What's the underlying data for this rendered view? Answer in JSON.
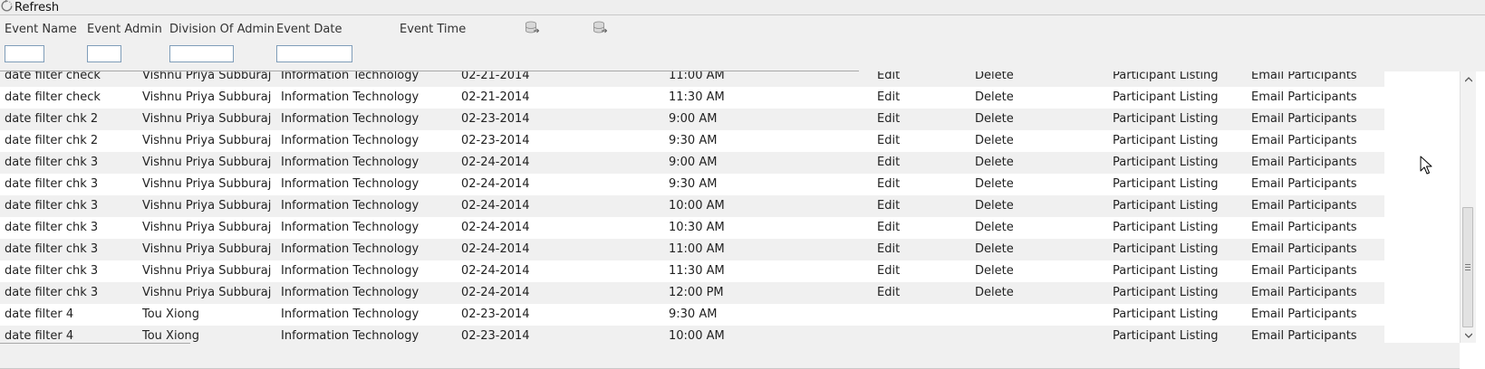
{
  "toolbar": {
    "refresh_label": "Refresh",
    "refresh_icon": "refresh-icon"
  },
  "headers": {
    "event_name": "Event Name",
    "event_admin": "Event Admin",
    "division_of_admin": "Division Of Admin",
    "event_date": "Event Date",
    "event_time": "Event Time",
    "export_icon_1": "database-export-icon",
    "export_icon_2": "database-export-icon"
  },
  "filters": {
    "event_name": "",
    "event_admin": "",
    "division_of_admin": "",
    "event_date": ""
  },
  "rows": [
    {
      "name": "date filter check",
      "admin": "Vishnu Priya Subburaj",
      "division": "Information Technology",
      "date": "02-21-2014",
      "time": "11:00 AM",
      "edit": "Edit",
      "delete": "Delete",
      "participant": "Participant Listing",
      "email": "Email Participants"
    },
    {
      "name": "date filter check",
      "admin": "Vishnu Priya Subburaj",
      "division": "Information Technology",
      "date": "02-21-2014",
      "time": "11:30 AM",
      "edit": "Edit",
      "delete": "Delete",
      "participant": "Participant Listing",
      "email": "Email Participants"
    },
    {
      "name": "date filter chk 2",
      "admin": "Vishnu Priya Subburaj",
      "division": "Information Technology",
      "date": "02-23-2014",
      "time": "9:00 AM",
      "edit": "Edit",
      "delete": "Delete",
      "participant": "Participant Listing",
      "email": "Email Participants"
    },
    {
      "name": "date filter chk 2",
      "admin": "Vishnu Priya Subburaj",
      "division": "Information Technology",
      "date": "02-23-2014",
      "time": "9:30 AM",
      "edit": "Edit",
      "delete": "Delete",
      "participant": "Participant Listing",
      "email": "Email Participants"
    },
    {
      "name": "date filter chk 3",
      "admin": "Vishnu Priya Subburaj",
      "division": "Information Technology",
      "date": "02-24-2014",
      "time": "9:00 AM",
      "edit": "Edit",
      "delete": "Delete",
      "participant": "Participant Listing",
      "email": "Email Participants"
    },
    {
      "name": "date filter chk 3",
      "admin": "Vishnu Priya Subburaj",
      "division": "Information Technology",
      "date": "02-24-2014",
      "time": "9:30 AM",
      "edit": "Edit",
      "delete": "Delete",
      "participant": "Participant Listing",
      "email": "Email Participants"
    },
    {
      "name": "date filter chk 3",
      "admin": "Vishnu Priya Subburaj",
      "division": "Information Technology",
      "date": "02-24-2014",
      "time": "10:00 AM",
      "edit": "Edit",
      "delete": "Delete",
      "participant": "Participant Listing",
      "email": "Email Participants"
    },
    {
      "name": "date filter chk 3",
      "admin": "Vishnu Priya Subburaj",
      "division": "Information Technology",
      "date": "02-24-2014",
      "time": "10:30 AM",
      "edit": "Edit",
      "delete": "Delete",
      "participant": "Participant Listing",
      "email": "Email Participants"
    },
    {
      "name": "date filter chk 3",
      "admin": "Vishnu Priya Subburaj",
      "division": "Information Technology",
      "date": "02-24-2014",
      "time": "11:00 AM",
      "edit": "Edit",
      "delete": "Delete",
      "participant": "Participant Listing",
      "email": "Email Participants"
    },
    {
      "name": "date filter chk 3",
      "admin": "Vishnu Priya Subburaj",
      "division": "Information Technology",
      "date": "02-24-2014",
      "time": "11:30 AM",
      "edit": "Edit",
      "delete": "Delete",
      "participant": "Participant Listing",
      "email": "Email Participants"
    },
    {
      "name": "date filter chk 3",
      "admin": "Vishnu Priya Subburaj",
      "division": "Information Technology",
      "date": "02-24-2014",
      "time": "12:00 PM",
      "edit": "Edit",
      "delete": "Delete",
      "participant": "Participant Listing",
      "email": "Email Participants"
    },
    {
      "name": "date filter 4",
      "admin": "Tou Xiong",
      "division": "Information Technology",
      "date": "02-23-2014",
      "time": "9:30 AM",
      "edit": "",
      "delete": "",
      "participant": "Participant Listing",
      "email": "Email Participants"
    },
    {
      "name": "date filter 4",
      "admin": "Tou Xiong",
      "division": "Information Technology",
      "date": "02-23-2014",
      "time": "10:00 AM",
      "edit": "",
      "delete": "",
      "participant": "Participant Listing",
      "email": "Email Participants"
    }
  ],
  "scrollbar": {
    "up_icon": "scroll-up-arrow-icon",
    "down_icon": "scroll-down-arrow-icon"
  },
  "cursor_icon": "mouse-pointer-icon"
}
